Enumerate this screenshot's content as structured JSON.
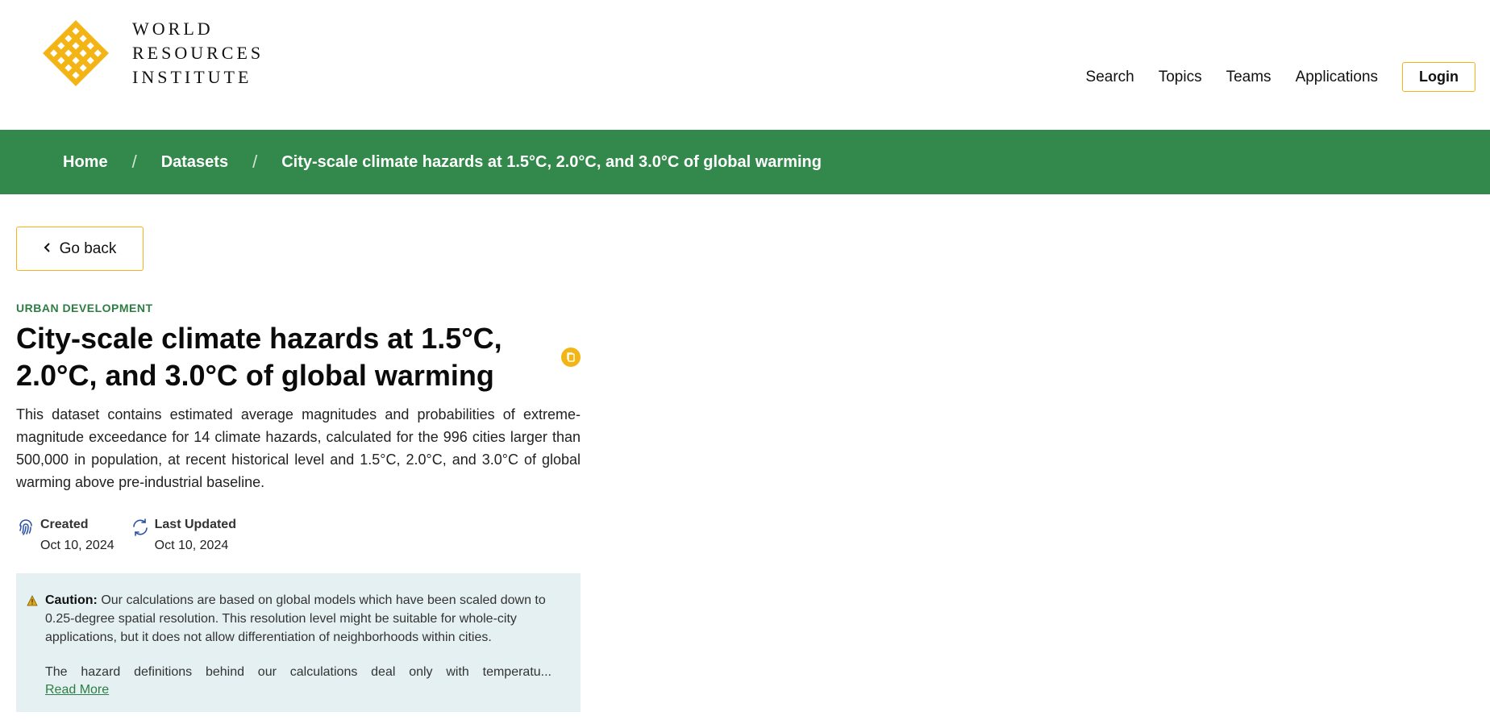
{
  "header": {
    "logo_lines": [
      "WORLD",
      "RESOURCES",
      "INSTITUTE"
    ],
    "logo_icon": "wri-knot-logo",
    "nav_items": [
      "Search",
      "Topics",
      "Teams",
      "Applications"
    ],
    "login_label": "Login"
  },
  "breadcrumb": {
    "items": [
      "Home",
      "Datasets"
    ],
    "separator": "/",
    "current": "City-scale climate hazards at 1.5°C, 2.0°C, and 3.0°C of global warming"
  },
  "back_button": {
    "label": "Go back",
    "icon": "chevron-left-icon"
  },
  "dataset": {
    "category": "URBAN DEVELOPMENT",
    "title": "City-scale climate hazards at 1.5°C, 2.0°C, and 3.0°C of global warming",
    "copy_icon": "copy-icon",
    "description": "This dataset contains estimated average magnitudes and probabilities of extreme-magnitude exceedance for 14 climate hazards, calculated for the 996 cities larger than 500,000 in population, at recent historical level and 1.5°C, 2.0°C, and 3.0°C of global warming above pre-industrial baseline.",
    "created_label": "Created",
    "created_value": "Oct 10, 2024",
    "created_icon": "fingerprint-icon",
    "updated_label": "Last Updated",
    "updated_value": "Oct 10, 2024",
    "updated_icon": "refresh-icon"
  },
  "caution": {
    "icon": "warning-icon",
    "label": "Caution:",
    "text1": " Our calculations are based on global models which have been scaled down to 0.25-degree spatial resolution. This resolution level might be suitable for whole-city applications, but it does not allow differentiation of neighborhoods within cities.",
    "text2": "The hazard definitions behind our calculations deal only with temperatu...",
    "read_more": "Read More"
  },
  "colors": {
    "brand_green": "#32894b",
    "accent_yellow": "#f3b515",
    "caution_bg": "#e5f0f2",
    "category_green": "#2e7d42"
  }
}
